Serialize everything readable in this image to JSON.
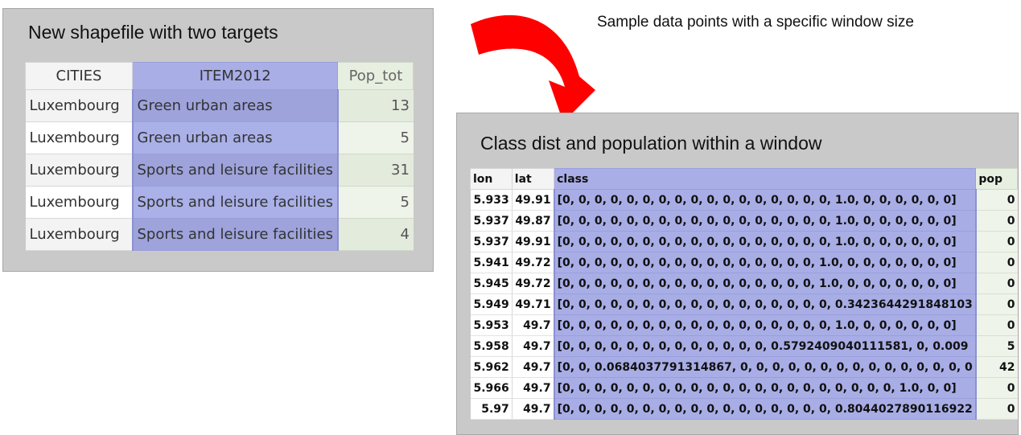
{
  "panel1": {
    "title": "New shapefile with two targets",
    "columns": [
      "CITIES",
      "ITEM2012",
      "Pop_tot"
    ],
    "rows": [
      [
        "Luxembourg",
        "Green urban areas",
        "13"
      ],
      [
        "Luxembourg",
        "Green urban areas",
        "5"
      ],
      [
        "Luxembourg",
        "Sports and leisure facilities",
        "31"
      ],
      [
        "Luxembourg",
        "Sports and leisure facilities",
        "5"
      ],
      [
        "Luxembourg",
        "Sports and leisure facilities",
        "4"
      ]
    ]
  },
  "note": "Sample data points with a specific window size",
  "panel2": {
    "title": "Class dist and population within a window",
    "columns": [
      "lon",
      "lat",
      "class",
      "pop"
    ],
    "rows": [
      [
        "5.933",
        "49.91",
        "[0, 0, 0, 0, 0, 0, 0, 0, 0, 0, 0, 0, 0, 0, 0, 0, 0, 1.0, 0, 0, 0, 0, 0, 0]",
        "0"
      ],
      [
        "5.937",
        "49.87",
        "[0, 0, 0, 0, 0, 0, 0, 0, 0, 0, 0, 0, 0, 0, 0, 0, 0, 1.0, 0, 0, 0, 0, 0, 0]",
        "0"
      ],
      [
        "5.937",
        "49.91",
        "[0, 0, 0, 0, 0, 0, 0, 0, 0, 0, 0, 0, 0, 0, 0, 0, 0, 1.0, 0, 0, 0, 0, 0, 0]",
        "0"
      ],
      [
        "5.941",
        "49.72",
        "[0, 0, 0, 0, 0, 0, 0, 0, 0, 0, 0, 0, 0, 0, 0, 0, 1.0, 0, 0, 0, 0, 0, 0, 0]",
        "0"
      ],
      [
        "5.945",
        "49.72",
        "[0, 0, 0, 0, 0, 0, 0, 0, 0, 0, 0, 0, 0, 0, 0, 0, 1.0, 0, 0, 0, 0, 0, 0, 0]",
        "0"
      ],
      [
        "5.949",
        "49.71",
        "[0, 0, 0, 0, 0, 0, 0, 0, 0, 0, 0, 0, 0, 0, 0, 0, 0, 0.3423644291848103",
        "0"
      ],
      [
        "5.953",
        "49.7",
        "[0, 0, 0, 0, 0, 0, 0, 0, 0, 0, 0, 0, 0, 0, 0, 0, 0, 1.0, 0, 0, 0, 0, 0, 0]",
        "0"
      ],
      [
        "5.958",
        "49.7",
        "[0, 0, 0, 0, 0, 0, 0, 0, 0, 0, 0, 0, 0, 0.5792409040111581, 0, 0.009",
        "5"
      ],
      [
        "5.962",
        "49.7",
        "[0, 0, 0.0684037791314867, 0, 0, 0, 0, 0, 0, 0, 0, 0, 0, 0, 0, 0, 0, 0",
        "42"
      ],
      [
        "5.966",
        "49.7",
        "[0, 0, 0, 0, 0, 0, 0, 0, 0, 0, 0, 0, 0, 0, 0, 0, 0, 0, 0, 0, 0, 1.0, 0, 0]",
        "0"
      ],
      [
        "5.97",
        "49.7",
        "[0, 0, 0, 0, 0, 0, 0, 0, 0, 0, 0, 0, 0, 0, 0, 0, 0, 0.8044027890116922",
        "0"
      ]
    ]
  },
  "colors": {
    "arrow": "#ff0000",
    "panel_bg": "#c9c9c9",
    "class_column": "#a8ade6",
    "pop_column": "#eef4ea"
  },
  "icons": [
    "curved-arrow-icon"
  ]
}
